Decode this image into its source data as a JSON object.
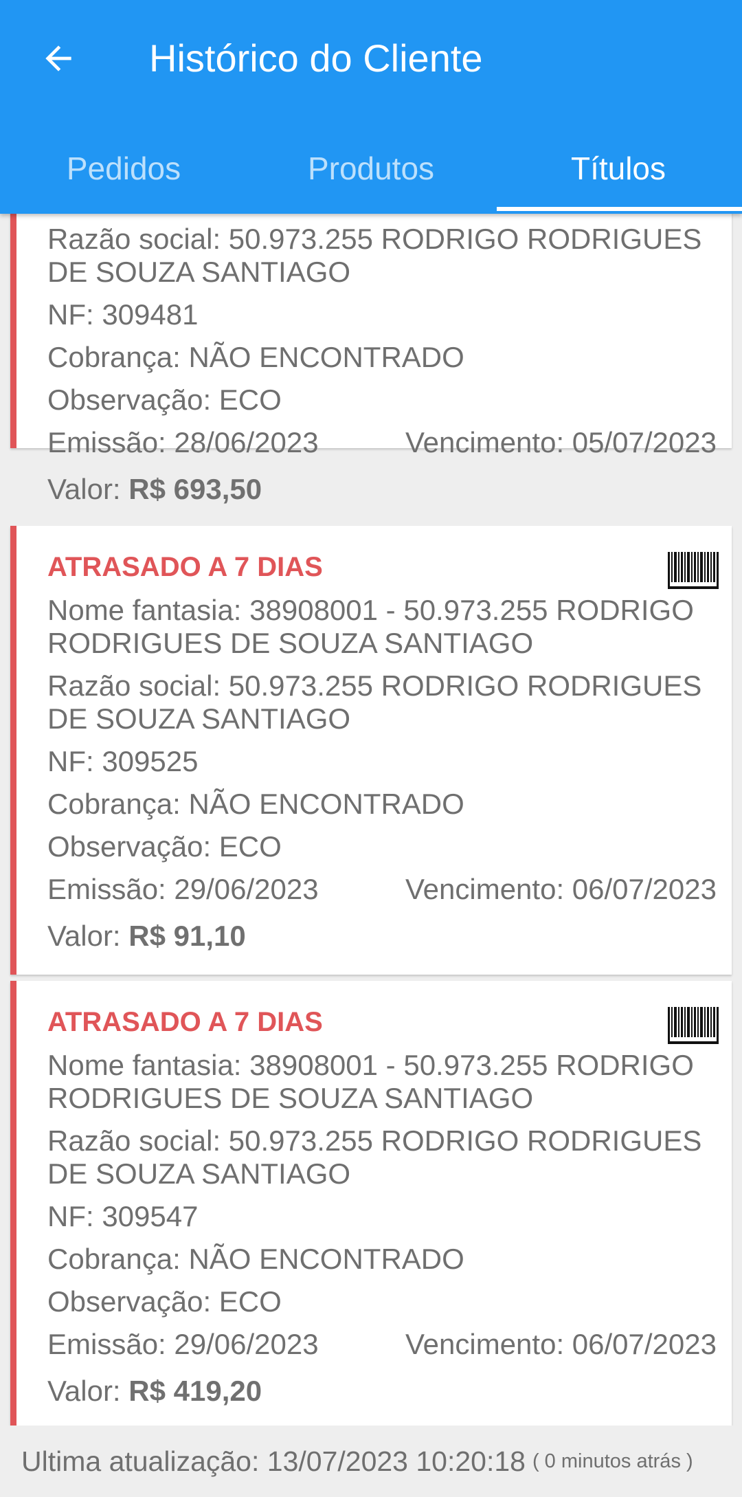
{
  "header": {
    "title": "Histórico do Cliente",
    "bg_color": "#2196f3",
    "back_icon": "arrow-back-icon"
  },
  "tabs": [
    {
      "label": "Pedidos",
      "active": false
    },
    {
      "label": "Produtos",
      "active": false
    },
    {
      "label": "Títulos",
      "active": true
    }
  ],
  "cards": [
    {
      "status": "",
      "razao_line1": "Razão social: 50.973.255 RODRIGO RODRIGUES",
      "razao_line2": "DE SOUZA SANTIAGO",
      "nf": "NF: 309481",
      "cobranca": "Cobrança: NÃO ENCONTRADO",
      "observacao": "Observação: ECO",
      "emissao": "Emissão: 28/06/2023",
      "vencimento": "Vencimento: 05/07/2023",
      "valor_label": "Valor: ",
      "valor": "R$ 693,50"
    },
    {
      "status": "ATRASADO A 7 DIAS",
      "nome_line1": "Nome fantasia: 38908001 - 50.973.255 RODRIGO",
      "nome_line2": "RODRIGUES DE SOUZA SANTIAGO",
      "razao_line1": "Razão social: 50.973.255 RODRIGO RODRIGUES",
      "razao_line2": "DE SOUZA SANTIAGO",
      "nf": "NF: 309525",
      "cobranca": "Cobrança: NÃO ENCONTRADO",
      "observacao": "Observação: ECO",
      "emissao": "Emissão: 29/06/2023",
      "vencimento": "Vencimento: 06/07/2023",
      "valor_label": "Valor: ",
      "valor": "R$ 91,10"
    },
    {
      "status": "ATRASADO A 7 DIAS",
      "nome_line1": "Nome fantasia: 38908001 - 50.973.255 RODRIGO",
      "nome_line2": "RODRIGUES DE SOUZA SANTIAGO",
      "razao_line1": "Razão social: 50.973.255 RODRIGO RODRIGUES",
      "razao_line2": "DE SOUZA SANTIAGO",
      "nf": "NF: 309547",
      "cobranca": "Cobrança: NÃO ENCONTRADO",
      "observacao": "Observação: ECO",
      "emissao": "Emissão: 29/06/2023",
      "vencimento": "Vencimento: 06/07/2023",
      "valor_label": "Valor: ",
      "valor": "R$ 419,20"
    }
  ],
  "status_color": "#e05558",
  "barcode_icon": "barcode-icon",
  "footer": {
    "last_update": "Ultima atualização: 13/07/2023 10:20:18",
    "ago": "( 0 minutos atrás )"
  }
}
